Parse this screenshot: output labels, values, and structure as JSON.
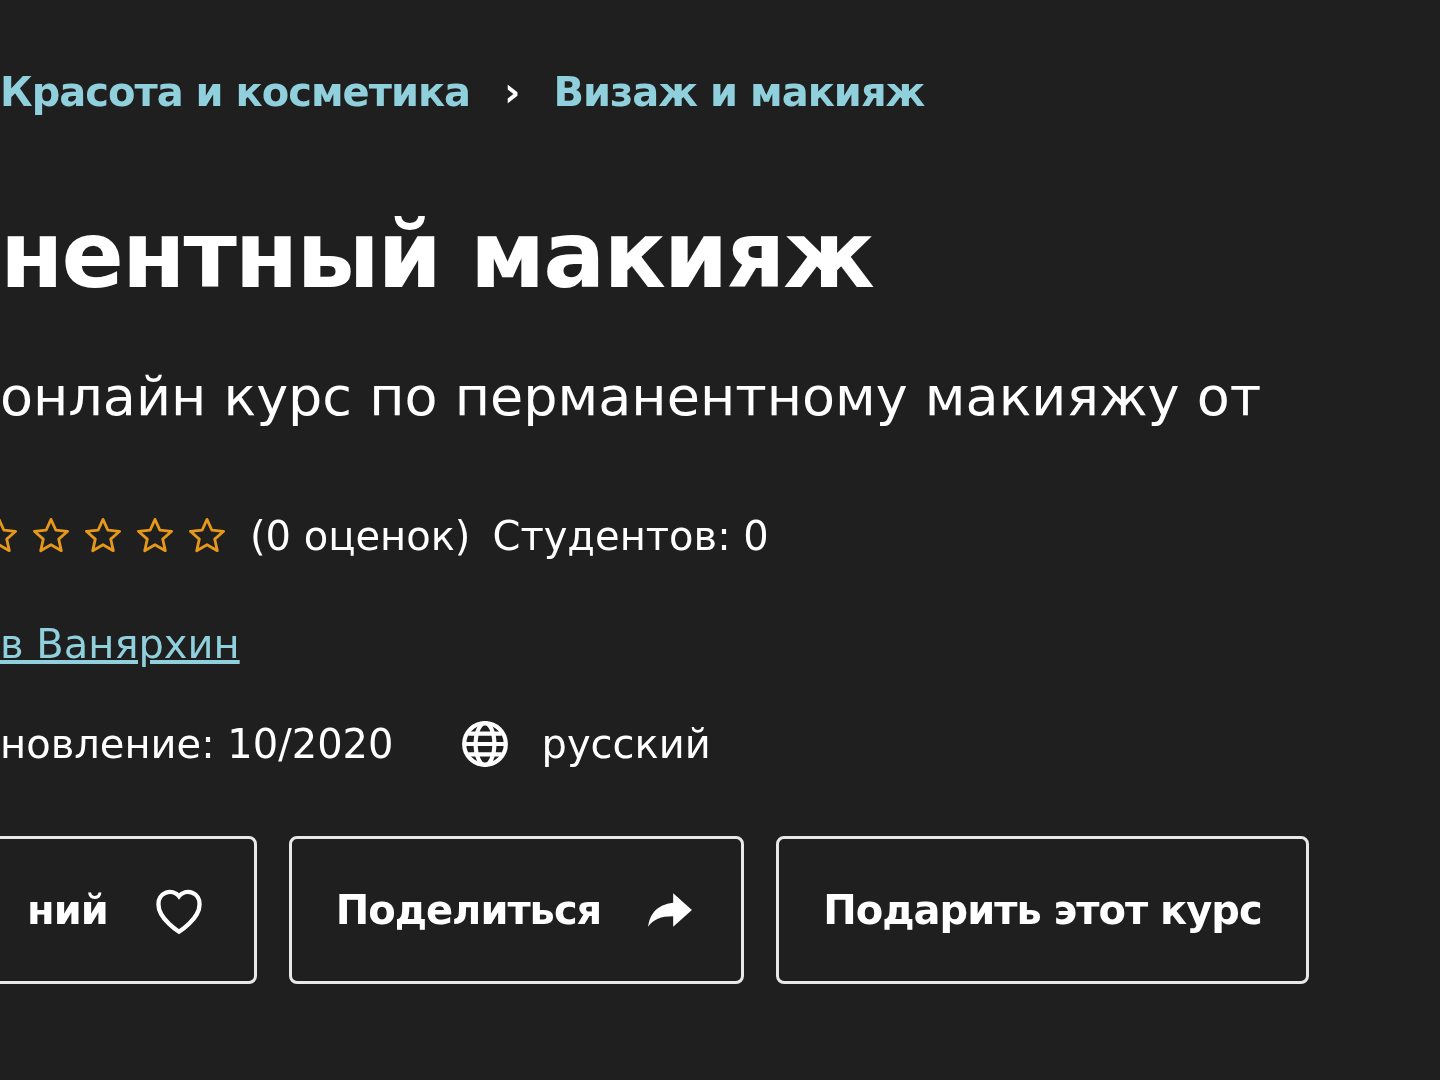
{
  "breadcrumbs": [
    {
      "label": "Красота и косметика"
    },
    {
      "label": "Визаж и макияж"
    }
  ],
  "separator": "›",
  "title": "нентный макияж",
  "subtitle": "онлайн курс по перманентному макияжу от",
  "rating": {
    "stars": 0,
    "count": "(0 оценок)",
    "students": "Студентов: 0"
  },
  "author": "в Ванярхин",
  "meta": {
    "updated": "новление: 10/2020",
    "language": "русский"
  },
  "buttons": [
    {
      "label": "ний",
      "kind": "wishlist"
    },
    {
      "label": "Поделиться",
      "kind": "share"
    },
    {
      "label": "Подарить этот курс",
      "kind": "plain"
    }
  ]
}
